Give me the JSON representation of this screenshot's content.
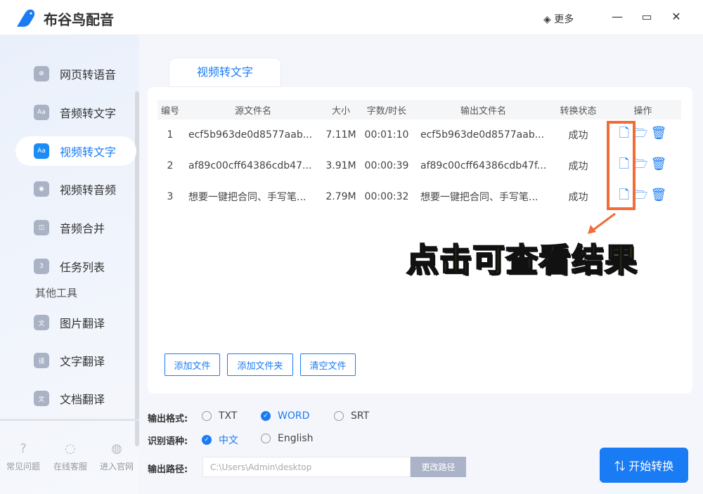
{
  "app": {
    "title": "布谷鸟配音",
    "more": "更多",
    "accent": "#1a7cf5"
  },
  "sidebar": {
    "items": [
      {
        "label": "网页转语音",
        "icon": "globe-icon"
      },
      {
        "label": "音频转文字",
        "icon": "audio-text-icon"
      },
      {
        "label": "视频转文字",
        "icon": "video-text-icon",
        "active": true
      },
      {
        "label": "视频转音频",
        "icon": "video-audio-icon"
      },
      {
        "label": "音频合并",
        "icon": "merge-icon"
      },
      {
        "label": "任务列表",
        "icon": "task-icon"
      }
    ],
    "section": "其他工具",
    "tools": [
      {
        "label": "图片翻译"
      },
      {
        "label": "文字翻译"
      },
      {
        "label": "文档翻译"
      }
    ],
    "footer": [
      {
        "label": "常见问题"
      },
      {
        "label": "在线客服"
      },
      {
        "label": "进入官网"
      }
    ]
  },
  "tab": "视频转文字",
  "table": {
    "headers": [
      "编号",
      "源文件名",
      "大小",
      "字数/时长",
      "输出文件名",
      "转换状态",
      "操作"
    ],
    "rows": [
      [
        "1",
        "ecf5b963de0d8577aab...",
        "7.11M",
        "00:01:10",
        "ecf5b963de0d8577aab...",
        "成功"
      ],
      [
        "2",
        "af89c00cff64386cdb47...",
        "3.91M",
        "00:00:39",
        "af89c00cff64386cdb47f...",
        "成功"
      ],
      [
        "3",
        "想要一键把合同、手写笔...",
        "2.79M",
        "00:00:32",
        "想要一键把合同、手写笔...",
        "成功"
      ]
    ]
  },
  "buttons": {
    "add_file": "添加文件",
    "add_folder": "添加文件夹",
    "clear": "清空文件"
  },
  "callout": "点击可查看结果",
  "settings": {
    "format_label": "输出格式:",
    "formats": [
      "TXT",
      "WORD",
      "SRT"
    ],
    "format_selected": "WORD",
    "lang_label": "识别语种:",
    "langs": [
      "中文",
      "English"
    ],
    "lang_selected": "中文",
    "path_label": "输出路径:",
    "path": "C:\\Users\\Admin\\desktop",
    "change_path": "更改路径"
  },
  "start": "开始转换"
}
